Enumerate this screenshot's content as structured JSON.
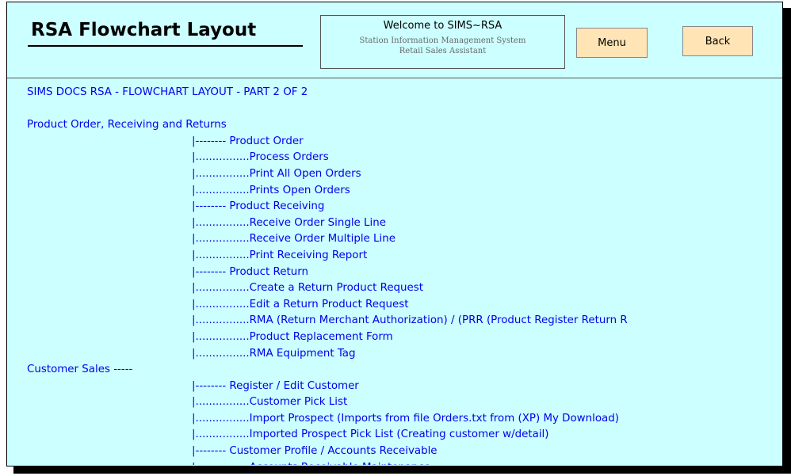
{
  "header": {
    "title": "RSA Flowchart Layout",
    "welcome": {
      "line1": "Welcome to SIMS~RSA",
      "line2": "Station Information Management System",
      "line3": "Retail Sales Assistant"
    },
    "menu_label": "Menu",
    "back_label": "Back"
  },
  "content": {
    "lines": [
      {
        "text": "SIMS DOCS RSA - FLOWCHART LAYOUT - PART 2 OF 2",
        "indent": false
      },
      {
        "text": "",
        "indent": false
      },
      {
        "text": "Product Order, Receiving and Returns",
        "indent": false
      },
      {
        "text": "|-------- Product Order",
        "indent": true
      },
      {
        "text": "|................Process Orders",
        "indent": true
      },
      {
        "text": "|................Print All Open Orders",
        "indent": true
      },
      {
        "text": "|................Prints Open Orders",
        "indent": true
      },
      {
        "text": "|-------- Product Receiving",
        "indent": true
      },
      {
        "text": "|................Receive Order Single Line",
        "indent": true
      },
      {
        "text": "|................Receive Order Multiple Line",
        "indent": true
      },
      {
        "text": "|................Print Receiving Report",
        "indent": true
      },
      {
        "text": "|-------- Product Return",
        "indent": true
      },
      {
        "text": "|................Create a Return Product Request",
        "indent": true
      },
      {
        "text": "|................Edit a Return Product Request",
        "indent": true
      },
      {
        "text": "|................RMA (Return Merchant Authorization) / (PRR (Product Register Return R",
        "indent": true
      },
      {
        "text": "|................Product Replacement Form",
        "indent": true
      },
      {
        "text": "|................RMA Equipment Tag",
        "indent": true
      },
      {
        "text": "Customer Sales -----",
        "indent": false
      },
      {
        "text": "|-------- Register / Edit Customer",
        "indent": true
      },
      {
        "text": "|................Customer Pick List",
        "indent": true
      },
      {
        "text": "|................Import Prospect (Imports from file Orders.txt from (XP) My Download)",
        "indent": true
      },
      {
        "text": "|................Imported Prospect Pick List (Creating customer w/detail)",
        "indent": true
      },
      {
        "text": "|-------- Customer Profile / Accounts Receivable",
        "indent": true
      },
      {
        "text": "|................Accounts Receivable Maintenance",
        "indent": true
      }
    ]
  }
}
